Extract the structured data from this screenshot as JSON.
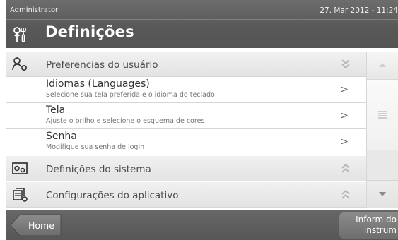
{
  "status": {
    "user": "Administrator",
    "datetime": "27. Mar 2012 - 11:24"
  },
  "header": {
    "title": "Definições",
    "icon": "settings-tools-icon"
  },
  "sections": [
    {
      "label": "Preferencias do usuário",
      "icon": "user-preferences-icon",
      "state": "expanded",
      "items": [
        {
          "title": "Idiomas (Languages)",
          "subtitle": "Selecione sua tela preferida e o idioma do teclado",
          "arrow": ">"
        },
        {
          "title": "Tela",
          "subtitle": "Ajuste o brilho e selecione o esquema de cores",
          "arrow": ">"
        },
        {
          "title": "Senha",
          "subtitle": "Modifique sua senha de login",
          "arrow": ">"
        }
      ]
    },
    {
      "label": "Definições do sistema",
      "icon": "system-settings-icon",
      "state": "collapsed"
    },
    {
      "label": "Configurações do aplicativo",
      "icon": "application-settings-icon",
      "state": "collapsed"
    }
  ],
  "footer": {
    "home_label": "Home",
    "info_label": "Inform do instrum"
  }
}
